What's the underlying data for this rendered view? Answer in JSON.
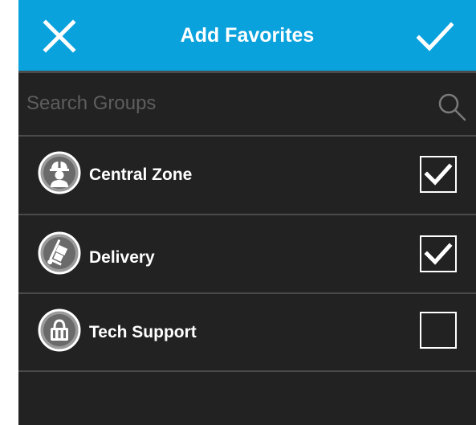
{
  "header": {
    "title": "Add Favorites",
    "close_icon": "close-icon",
    "confirm_icon": "checkmark-icon",
    "background_color": "#09a2dd"
  },
  "search": {
    "placeholder": "Search Groups",
    "value": "",
    "icon": "search-icon"
  },
  "groups": [
    {
      "label": "Central Zone",
      "icon": "construction-worker-icon",
      "checked": true
    },
    {
      "label": "Delivery",
      "icon": "hand-truck-icon",
      "checked": true
    },
    {
      "label": "Tech Support",
      "icon": "tools-icon",
      "checked": false
    }
  ]
}
